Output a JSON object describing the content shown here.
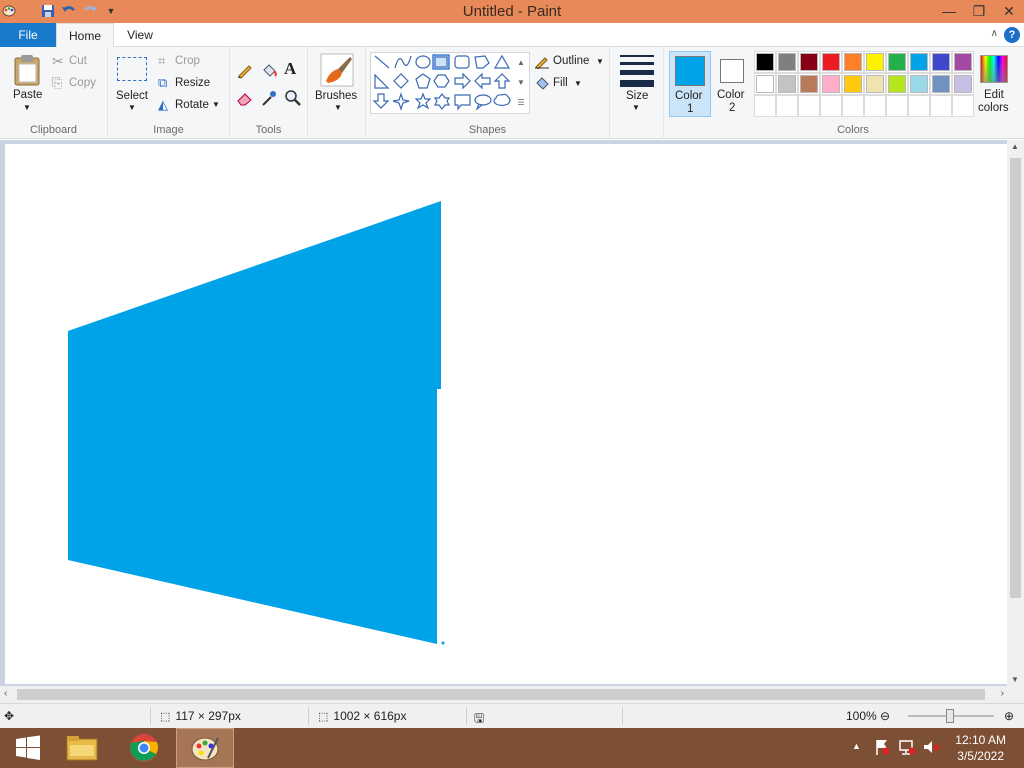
{
  "window": {
    "title": "Untitled - Paint"
  },
  "tabs": {
    "file": "File",
    "home": "Home",
    "view": "View"
  },
  "clipboard": {
    "paste": "Paste",
    "cut": "Cut",
    "copy": "Copy",
    "label": "Clipboard"
  },
  "image": {
    "select": "Select",
    "crop": "Crop",
    "resize": "Resize",
    "rotate": "Rotate",
    "label": "Image"
  },
  "tools": {
    "label": "Tools"
  },
  "brushes": {
    "label": "Brushes"
  },
  "shapes": {
    "outline": "Outline",
    "fill": "Fill",
    "label": "Shapes"
  },
  "size": {
    "label": "Size"
  },
  "color1": {
    "line1": "Color",
    "line2": "1",
    "value": "#00a2e8"
  },
  "color2": {
    "line1": "Color",
    "line2": "2",
    "value": "#ffffff"
  },
  "colors": {
    "label": "Colors",
    "row1": [
      "#000000",
      "#7f7f7f",
      "#880015",
      "#ed1c24",
      "#ff7f27",
      "#fff200",
      "#22b14c",
      "#00a2e8",
      "#3f48cc",
      "#a349a4"
    ],
    "row2": [
      "#ffffff",
      "#c3c3c3",
      "#b97a57",
      "#ffaec9",
      "#ffc90e",
      "#efe4b0",
      "#b5e61d",
      "#99d9ea",
      "#7092be",
      "#c8bfe7"
    ]
  },
  "edit_colors": {
    "line1": "Edit",
    "line2": "colors"
  },
  "canvas": {
    "shape_color": "#00a2e8"
  },
  "status": {
    "selection_size": "117 × 297px",
    "canvas_size": "1002 × 616px",
    "zoom": "100%"
  },
  "taskbar": {
    "time": "12:10 AM",
    "date": "3/5/2022"
  }
}
